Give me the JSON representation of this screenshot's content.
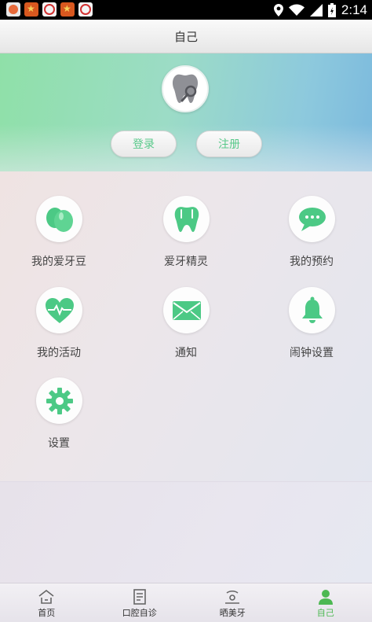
{
  "status_bar": {
    "time": "2:14",
    "notification_icons": [
      "app-icon",
      "app-icon",
      "app-icon",
      "app-icon",
      "app-icon"
    ],
    "system_icons": [
      "location-icon",
      "wifi-icon",
      "signal-icon",
      "battery-icon"
    ]
  },
  "header": {
    "title": "自己"
  },
  "profile": {
    "avatar_icon": "tooth-icon",
    "login_label": "登录",
    "register_label": "注册"
  },
  "menu": [
    {
      "label": "我的爱牙豆",
      "icon": "beans-icon"
    },
    {
      "label": "爱牙精灵",
      "icon": "tooth-icon"
    },
    {
      "label": "我的预约",
      "icon": "chat-bubble-icon"
    },
    {
      "label": "我的活动",
      "icon": "heart-pulse-icon"
    },
    {
      "label": "通知",
      "icon": "mail-icon"
    },
    {
      "label": "闹钟设置",
      "icon": "bell-icon"
    },
    {
      "label": "设置",
      "icon": "gear-icon"
    }
  ],
  "tabs": [
    {
      "label": "首页",
      "icon": "home-icon",
      "active": false
    },
    {
      "label": "口腔自诊",
      "icon": "document-icon",
      "active": false
    },
    {
      "label": "晒美牙",
      "icon": "smile-icon",
      "active": false
    },
    {
      "label": "自己",
      "icon": "person-icon",
      "active": true
    }
  ],
  "colors": {
    "accent_green": "#4cc985",
    "active_tab": "#4cb852",
    "banner_left": "#8fe0a8",
    "banner_right": "#7bb9dd"
  }
}
